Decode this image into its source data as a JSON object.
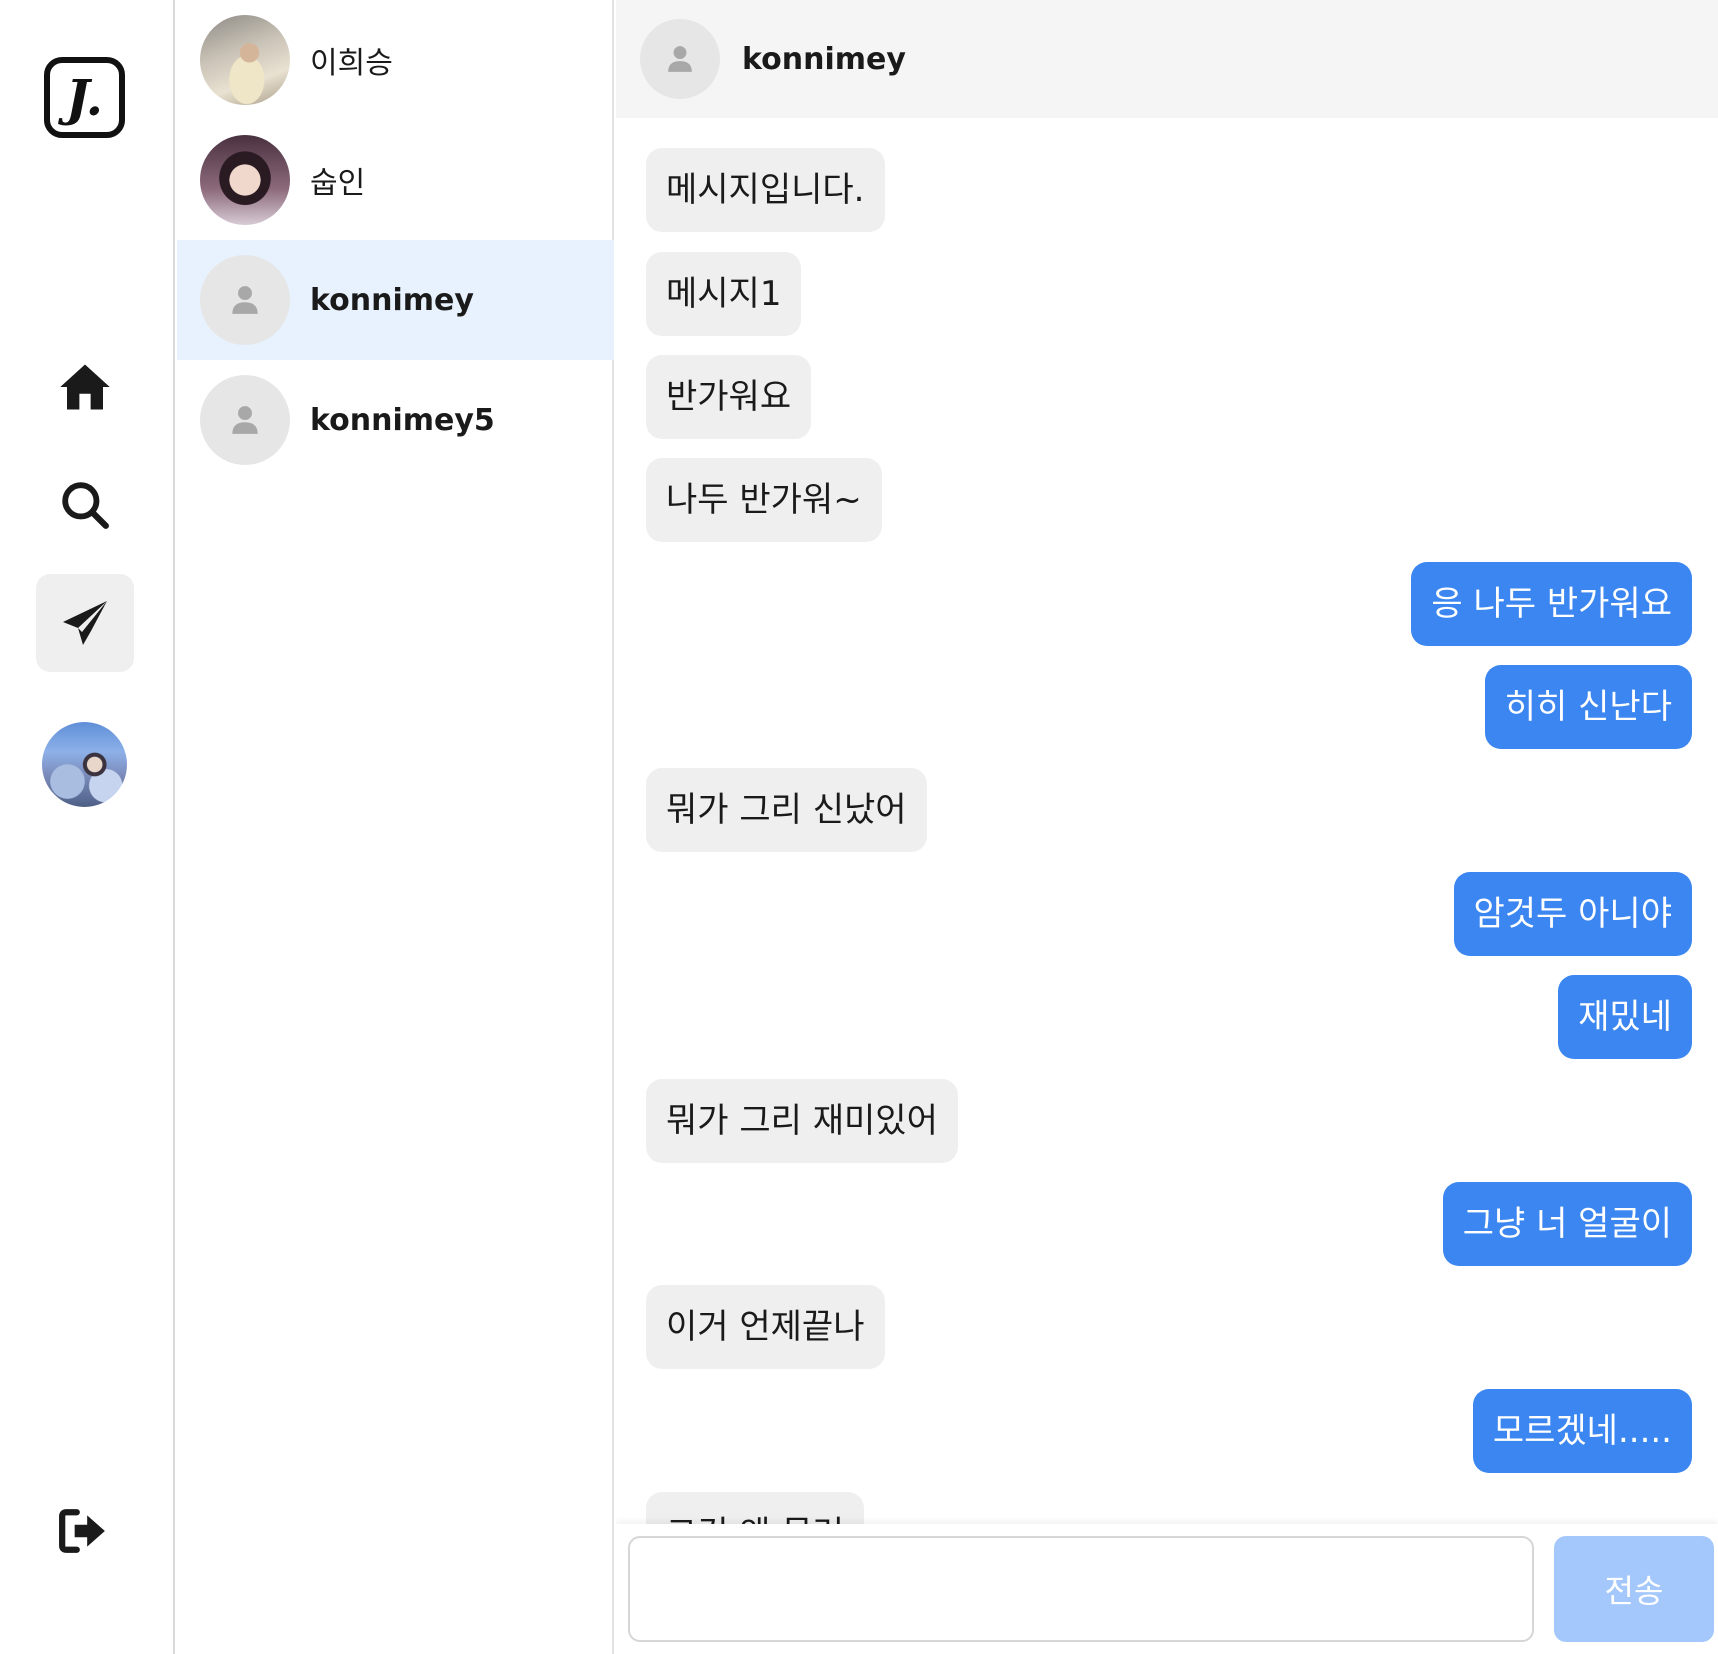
{
  "app": {
    "logo_text": "J.",
    "nav": [
      {
        "icon": "home-icon"
      },
      {
        "icon": "search-icon"
      },
      {
        "icon": "paper-plane-icon",
        "active": true
      },
      {
        "icon": "profile-avatar"
      }
    ],
    "logout_icon": "logout-icon"
  },
  "conversations": [
    {
      "name": "이희승",
      "avatar": "photo",
      "bold": false
    },
    {
      "name": "숩인",
      "avatar": "photo",
      "bold": false
    },
    {
      "name": "konnimey",
      "avatar": "default-user-icon",
      "bold": true,
      "selected": true
    },
    {
      "name": "konnimey5",
      "avatar": "default-user-icon",
      "bold": true
    }
  ],
  "chat": {
    "title": "konnimey",
    "messages": [
      {
        "text": "메시지입니다.",
        "from": "them"
      },
      {
        "text": "메시지1",
        "from": "them"
      },
      {
        "text": "반가워요",
        "from": "them"
      },
      {
        "text": "나두 반가워~",
        "from": "them"
      },
      {
        "text": "응 나두 반가워요",
        "from": "me"
      },
      {
        "text": "히히 신난다",
        "from": "me"
      },
      {
        "text": "뭐가 그리 신났어",
        "from": "them"
      },
      {
        "text": "암것두 아니야",
        "from": "me"
      },
      {
        "text": "재밌네",
        "from": "me"
      },
      {
        "text": "뭐가 그리 재미있어",
        "from": "them"
      },
      {
        "text": "그냥 너 얼굴이",
        "from": "me"
      },
      {
        "text": "이거 언제끝나",
        "from": "them"
      },
      {
        "text": "모르겠네.....",
        "from": "me"
      },
      {
        "text": "그건 왜 물러",
        "from": "them"
      }
    ],
    "input_value": "",
    "send_label": "전송"
  },
  "colors": {
    "accent": "#3b86f0",
    "send_disabled": "#a4c8fb",
    "selected_row": "#e8f2fe",
    "incoming_bubble": "#efefef"
  }
}
